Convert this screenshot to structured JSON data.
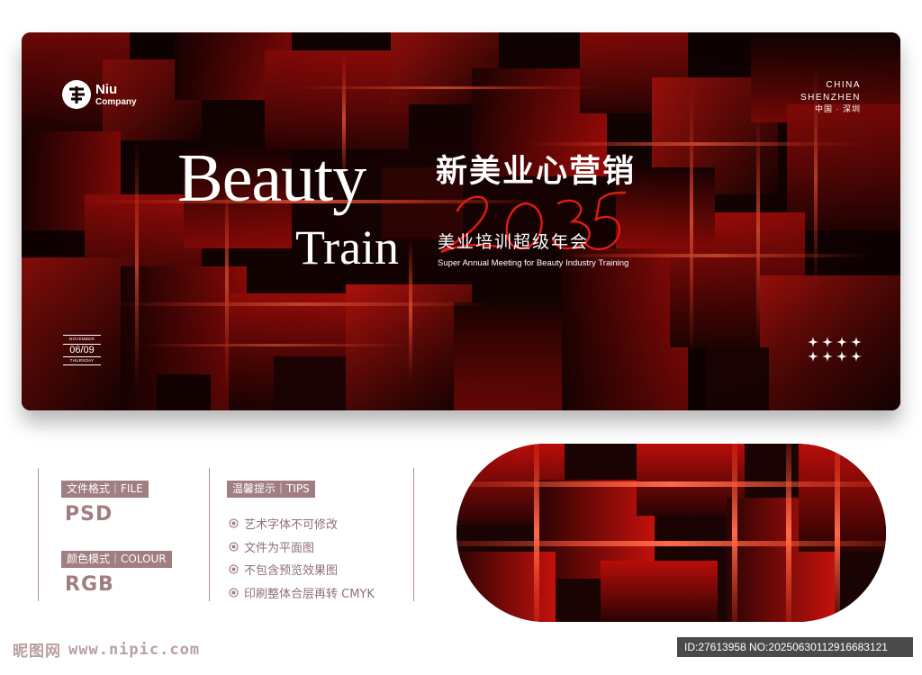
{
  "banner": {
    "logo": {
      "line1": "Niu",
      "line2": "Company"
    },
    "location": {
      "line1": "CHINA",
      "line2": "SHENZHEN",
      "line3": "中国 · 深圳"
    },
    "title_en": {
      "line1": "Beauty",
      "line2": "Train"
    },
    "year": "2035",
    "title_cn": "新美业心营销",
    "subtitle_cn": "美业培训超级年会",
    "subtitle_en": "Super Annual Meeting for Beauty Industry Training",
    "date": {
      "month": "NOVEMBER",
      "day": "06/09",
      "weekday": "THURSDAY"
    },
    "colors": {
      "background": "#140202",
      "accent": "#d8120f",
      "year_script": "#e21a14"
    }
  },
  "info": {
    "file_format": {
      "label": "文件格式｜FILE",
      "value": "PSD"
    },
    "color_mode": {
      "label": "颜色模式｜COLOUR",
      "value": "RGB"
    },
    "tips": {
      "label": "温馨提示｜TIPS",
      "items": [
        "艺术字体不可修改",
        "文件为平面图",
        "不包含预览效果图",
        "印刷整体合层再转 CMYK"
      ]
    },
    "colors": {
      "tag_bg": "#a07e82",
      "text": "#8f7074"
    }
  },
  "footer": {
    "logo_cn": "昵图网",
    "url": "www.nipic.com",
    "id_text": "ID:27613958 NO:20250630112916683121"
  }
}
